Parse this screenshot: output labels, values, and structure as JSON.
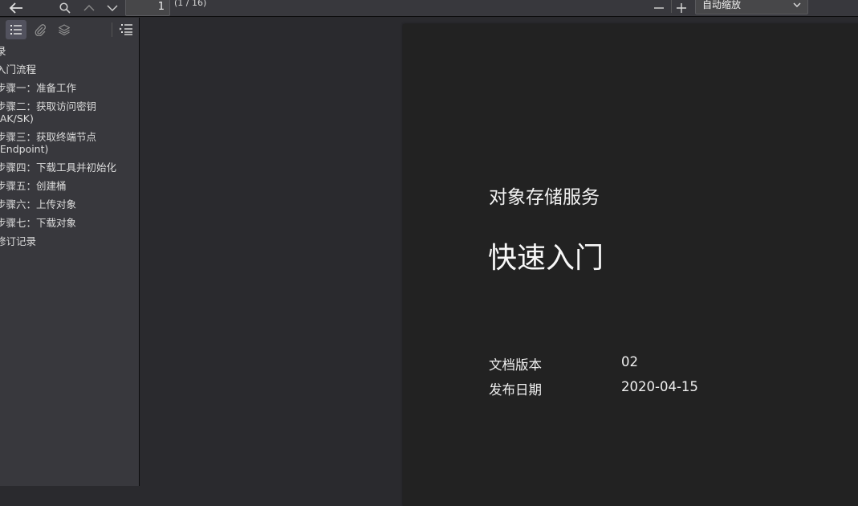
{
  "toolbar": {
    "page_number": "1",
    "page_count": "(1 / 16)",
    "zoom_value": "自动缩放"
  },
  "sidebar": {
    "items": [
      {
        "label": "录"
      },
      {
        "label": "入门流程"
      },
      {
        "label": "步骤一：准备工作"
      },
      {
        "label": "步骤二：获取访问密钥\n(AK/SK)"
      },
      {
        "label": "步骤三：获取终端节点\n(Endpoint)"
      },
      {
        "label": "步骤四：下载工具并初始化"
      },
      {
        "label": "步骤五：创建桶"
      },
      {
        "label": "步骤六：上传对象"
      },
      {
        "label": "步骤七：下载对象"
      },
      {
        "label": "修订记录"
      }
    ]
  },
  "document": {
    "service": "对象存储服务",
    "title": "快速入门",
    "version_label": "文档版本",
    "version_value": "02",
    "date_label": "发布日期",
    "date_value": "2020-04-15"
  },
  "icons": {
    "back": "arrow-left-icon",
    "search": "search-icon",
    "prev": "chevron-up-icon",
    "next": "chevron-down-icon",
    "zoom_out": "minus-icon",
    "zoom_in": "plus-icon",
    "outline": "outline-icon",
    "attachments": "paperclip-icon",
    "layers": "layers-icon",
    "current_outline": "current-outline-icon"
  },
  "colors": {
    "toolbar_bg": "#38383d",
    "viewer_bg": "#2a2a2e",
    "page_bg": "#222222"
  }
}
